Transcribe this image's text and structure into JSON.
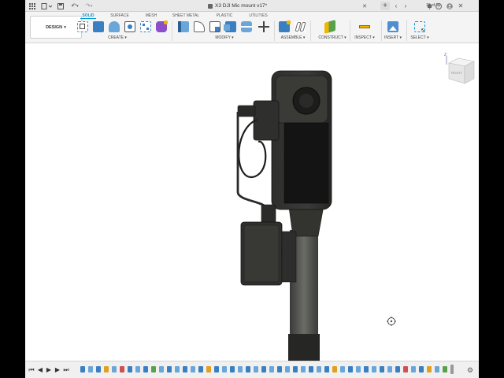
{
  "app": {
    "document_title": "X3 DJI Mic mount v17*",
    "job_status": "10 of 10"
  },
  "toolbar": {
    "design_label": "DESIGN",
    "tabs": [
      {
        "label": "SOLID",
        "active": true
      },
      {
        "label": "SURFACE",
        "active": false
      },
      {
        "label": "MESH",
        "active": false
      },
      {
        "label": "SHEET METAL",
        "active": false
      },
      {
        "label": "PLASTIC",
        "active": false
      },
      {
        "label": "UTILITIES",
        "active": false
      }
    ],
    "groups": [
      {
        "label": "CREATE ▾"
      },
      {
        "label": "MODIFY ▾"
      },
      {
        "label": "ASSEMBLE ▾"
      },
      {
        "label": "CONSTRUCT ▾"
      },
      {
        "label": "INSPECT ▾"
      },
      {
        "label": "INSERT ▾"
      },
      {
        "label": "SELECT ▾"
      }
    ]
  },
  "viewcube": {
    "face_label": "RIGHT",
    "axis_label": "Z"
  },
  "colors": {
    "accent": "#0696d7",
    "body_dark": "#2c2d2b",
    "pole": "#5a5b56"
  },
  "icons": {
    "grid": "app-grid-icon",
    "file": "file-icon",
    "save": "save-icon",
    "undo": "undo-icon",
    "redo": "redo-icon",
    "close": "close-icon",
    "new_tab": "plus-icon",
    "back": "arrow-left-icon",
    "forward": "arrow-right-icon",
    "notifications": "bell-icon",
    "help": "help-icon",
    "profile": "avatar-icon",
    "orbit_cursor": "orbit-cursor-icon",
    "settings": "gear-icon"
  }
}
